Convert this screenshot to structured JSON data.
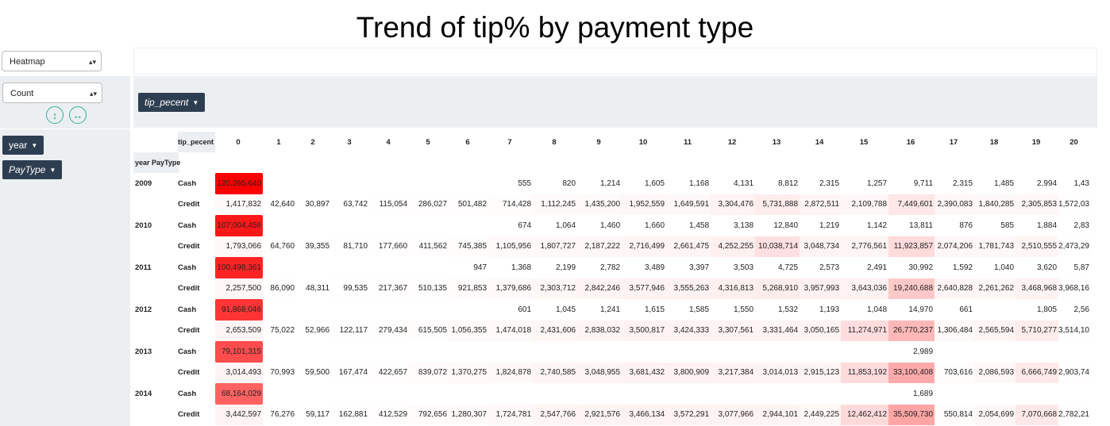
{
  "title": "Trend of tip% by payment type",
  "renderer_select": {
    "value": "Heatmap"
  },
  "aggregator_select": {
    "value": "Count"
  },
  "buttons": {
    "sort_rows": "↕",
    "sort_cols": "↔"
  },
  "col_attr": {
    "label": "tip_pecent"
  },
  "row_attrs": [
    {
      "label": "year"
    },
    {
      "label": "PayType"
    }
  ],
  "table": {
    "col_header_label": "tip_pecent",
    "row_header_label": "year PayType",
    "columns": [
      "0",
      "1",
      "2",
      "3",
      "4",
      "5",
      "6",
      "7",
      "8",
      "9",
      "10",
      "11",
      "12",
      "13",
      "14",
      "15",
      "16",
      "17",
      "18",
      "19",
      "20"
    ],
    "rows": [
      {
        "year": "2009",
        "pay": "Cash",
        "cells": [
          "120,265,640",
          "",
          "",
          "",
          "",
          "",
          "",
          "555",
          "820",
          "1,214",
          "1,605",
          "1,168",
          "4,131",
          "8,812",
          "2,315",
          "1,257",
          "9,711",
          "2,315",
          "1,485",
          "2,994",
          "1,43"
        ]
      },
      {
        "year": "",
        "pay": "Credit",
        "cells": [
          "1,417,832",
          "42,640",
          "30,897",
          "63,742",
          "115,054",
          "286,027",
          "501,482",
          "714,428",
          "1,112,245",
          "1,435,200",
          "1,952,559",
          "1,649,591",
          "3,304,476",
          "5,731,888",
          "2,872,511",
          "2,109,788",
          "7,449,601",
          "2,390,083",
          "1,840,285",
          "2,305,853",
          "1,572,03"
        ]
      },
      {
        "year": "2010",
        "pay": "Cash",
        "cells": [
          "107,004,456",
          "",
          "",
          "",
          "",
          "",
          "",
          "674",
          "1,064",
          "1,460",
          "1,660",
          "1,458",
          "3,138",
          "12,840",
          "1,219",
          "1,142",
          "13,811",
          "876",
          "585",
          "1,884",
          "2,83"
        ]
      },
      {
        "year": "",
        "pay": "Credit",
        "cells": [
          "1,793,066",
          "64,760",
          "39,355",
          "81,710",
          "177,660",
          "411,562",
          "745,385",
          "1,105,956",
          "1,807,727",
          "2,187,222",
          "2,716,499",
          "2,661,475",
          "4,252,255",
          "10,038,714",
          "3,048,734",
          "2,776,561",
          "11,923,857",
          "2,074,206",
          "1,781,743",
          "2,510,555",
          "2,473,29"
        ]
      },
      {
        "year": "2011",
        "pay": "Cash",
        "cells": [
          "100,498,361",
          "",
          "",
          "",
          "",
          "",
          "947",
          "1,368",
          "2,199",
          "2,782",
          "3,489",
          "3,397",
          "3,503",
          "4,725",
          "2,573",
          "2,491",
          "30,992",
          "1,592",
          "1,040",
          "3,620",
          "5,87"
        ]
      },
      {
        "year": "",
        "pay": "Credit",
        "cells": [
          "2,257,500",
          "86,090",
          "48,311",
          "99,535",
          "217,367",
          "510,135",
          "921,853",
          "1,379,686",
          "2,303,712",
          "2,842,246",
          "3,577,946",
          "3,555,263",
          "4,316,813",
          "5,268,910",
          "3,957,993",
          "3,643,036",
          "19,240,688",
          "2,640,828",
          "2,261,262",
          "3,468,968",
          "3,968,16"
        ]
      },
      {
        "year": "2012",
        "pay": "Cash",
        "cells": [
          "91,868,046",
          "",
          "",
          "",
          "",
          "",
          "",
          "601",
          "1,045",
          "1,241",
          "1,615",
          "1,585",
          "1,550",
          "1,532",
          "1,193",
          "1,048",
          "14,970",
          "661",
          "",
          "1,805",
          "2,56"
        ]
      },
      {
        "year": "",
        "pay": "Credit",
        "cells": [
          "2,653,509",
          "75,022",
          "52,966",
          "122,117",
          "279,434",
          "615,505",
          "1,056,355",
          "1,474,018",
          "2,431,606",
          "2,838,032",
          "3,500,817",
          "3,424,333",
          "3,307,561",
          "3,331,464",
          "3,050,165",
          "11,274,971",
          "26,770,237",
          "1,306,484",
          "2,565,594",
          "5,710,277",
          "3,514,10"
        ]
      },
      {
        "year": "2013",
        "pay": "Cash",
        "cells": [
          "79,101,315",
          "",
          "",
          "",
          "",
          "",
          "",
          "",
          "",
          "",
          "",
          "",
          "",
          "",
          "",
          "",
          "2,989",
          "",
          "",
          "",
          ""
        ]
      },
      {
        "year": "",
        "pay": "Credit",
        "cells": [
          "3,014,493",
          "70,993",
          "59,500",
          "167,474",
          "422,657",
          "839,072",
          "1,370,275",
          "1,824,878",
          "2,740,585",
          "3,048,955",
          "3,681,432",
          "3,800,909",
          "3,217,384",
          "3,014,013",
          "2,915,123",
          "11,853,192",
          "33,100,408",
          "703,616",
          "2,086,593",
          "6,666,749",
          "2,903,74"
        ]
      },
      {
        "year": "2014",
        "pay": "Cash",
        "cells": [
          "68,164,029",
          "",
          "",
          "",
          "",
          "",
          "",
          "",
          "",
          "",
          "",
          "",
          "",
          "",
          "",
          "",
          "1,689",
          "",
          "",
          "",
          ""
        ]
      },
      {
        "year": "",
        "pay": "Credit",
        "cells": [
          "3,442,597",
          "76,276",
          "59,117",
          "162,881",
          "412,529",
          "792,656",
          "1,280,307",
          "1,724,781",
          "2,547,766",
          "2,921,576",
          "3,466,134",
          "3,572,291",
          "3,077,966",
          "2,944,101",
          "2,449,225",
          "12,462,412",
          "35,509,730",
          "550,814",
          "2,054,699",
          "7,070,668",
          "2,782,21"
        ]
      }
    ]
  },
  "colors": {
    "heat_max": "#ff0000",
    "pill_bg": "#2e3e51",
    "accent": "#2eb39a",
    "panel_bg": "#eceff1"
  }
}
